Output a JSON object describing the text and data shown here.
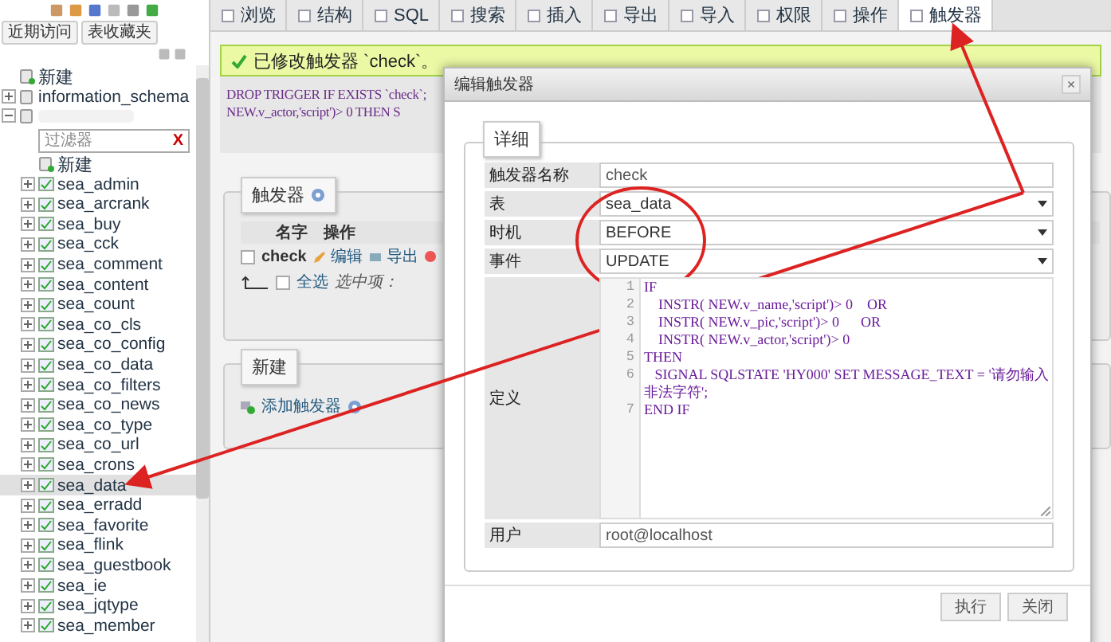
{
  "sidebar": {
    "tabs": [
      {
        "label": "近期访问"
      },
      {
        "label": "表收藏夹"
      }
    ],
    "tree": [
      {
        "kind": "new",
        "label": "新建"
      },
      {
        "kind": "db",
        "label": "information_schema",
        "expanded": false
      },
      {
        "kind": "hidden-db",
        "expanded": true,
        "filter": {
          "placeholder": "过滤器",
          "clear": "X"
        },
        "children": [
          {
            "kind": "new",
            "label": "新建"
          },
          {
            "kind": "table",
            "label": "sea_admin",
            "selected": false
          },
          {
            "kind": "table",
            "label": "sea_arcrank",
            "selected": false
          },
          {
            "kind": "table",
            "label": "sea_buy",
            "selected": false
          },
          {
            "kind": "table",
            "label": "sea_cck",
            "selected": false
          },
          {
            "kind": "table",
            "label": "sea_comment",
            "selected": false
          },
          {
            "kind": "table",
            "label": "sea_content",
            "selected": false
          },
          {
            "kind": "table",
            "label": "sea_count",
            "selected": false
          },
          {
            "kind": "table",
            "label": "sea_co_cls",
            "selected": false
          },
          {
            "kind": "table",
            "label": "sea_co_config",
            "selected": false
          },
          {
            "kind": "table",
            "label": "sea_co_data",
            "selected": false
          },
          {
            "kind": "table",
            "label": "sea_co_filters",
            "selected": false
          },
          {
            "kind": "table",
            "label": "sea_co_news",
            "selected": false
          },
          {
            "kind": "table",
            "label": "sea_co_type",
            "selected": false
          },
          {
            "kind": "table",
            "label": "sea_co_url",
            "selected": false
          },
          {
            "kind": "table",
            "label": "sea_crons",
            "selected": false
          },
          {
            "kind": "table",
            "label": "sea_data",
            "selected": true
          },
          {
            "kind": "table",
            "label": "sea_erradd",
            "selected": false
          },
          {
            "kind": "table",
            "label": "sea_favorite",
            "selected": false
          },
          {
            "kind": "table",
            "label": "sea_flink",
            "selected": false
          },
          {
            "kind": "table",
            "label": "sea_guestbook",
            "selected": false
          },
          {
            "kind": "table",
            "label": "sea_ie",
            "selected": false
          },
          {
            "kind": "table",
            "label": "sea_jqtype",
            "selected": false
          },
          {
            "kind": "table",
            "label": "sea_member",
            "selected": false
          }
        ]
      }
    ]
  },
  "tabs": [
    {
      "label": "浏览",
      "selected": false
    },
    {
      "label": "结构",
      "selected": false
    },
    {
      "label": "SQL",
      "selected": false
    },
    {
      "label": "搜索",
      "selected": false
    },
    {
      "label": "插入",
      "selected": false
    },
    {
      "label": "导出",
      "selected": false
    },
    {
      "label": "导入",
      "selected": false
    },
    {
      "label": "权限",
      "selected": false
    },
    {
      "label": "操作",
      "selected": false
    },
    {
      "label": "触发器",
      "selected": true
    }
  ],
  "message": {
    "text": "已修改触发器 `check`。"
  },
  "sql_preview": {
    "lines": [
      "DROP TRIGGER IF EXISTS `check`;",
      "NEW.v_actor,'script')> 0 THEN S"
    ]
  },
  "triggers_panel": {
    "legend": "触发器",
    "columns": [
      "名字",
      "操作"
    ],
    "rows": [
      {
        "name": "check",
        "checked": false,
        "actions": [
          {
            "kind": "edit",
            "label": "编辑"
          },
          {
            "kind": "export",
            "label": "导出"
          }
        ]
      }
    ],
    "footer": {
      "checked": false,
      "select_all": "全选",
      "with_selected": "选中项："
    }
  },
  "new_panel": {
    "legend": "新建",
    "link": "添加触发器"
  },
  "dialog": {
    "title": "编辑触发器",
    "close": "×",
    "legend": "详细",
    "fields": [
      {
        "kind": "text",
        "label": "触发器名称",
        "value": "check"
      },
      {
        "kind": "select",
        "label": "表",
        "value": "sea_data"
      },
      {
        "kind": "select",
        "label": "时机",
        "value": "BEFORE"
      },
      {
        "kind": "select",
        "label": "事件",
        "value": "UPDATE"
      },
      {
        "kind": "code",
        "label": "定义",
        "lines": [
          {
            "number": "1",
            "text": "IF"
          },
          {
            "number": "2",
            "text": "    INSTR( NEW.v_name,'script')> 0    OR"
          },
          {
            "number": "3",
            "text": "    INSTR( NEW.v_pic,'script')> 0      OR"
          },
          {
            "number": "4",
            "text": "    INSTR( NEW.v_actor,'script')> 0"
          },
          {
            "number": "5",
            "text": "THEN"
          },
          {
            "number": "6",
            "text": "   SIGNAL SQLSTATE 'HY000' SET MESSAGE_TEXT = '请勿输入非法字符';"
          },
          {
            "number": "7",
            "text": "END IF"
          }
        ]
      },
      {
        "kind": "text",
        "label": "用户",
        "value": "root@localhost"
      }
    ],
    "buttons": [
      "执行",
      "关闭"
    ]
  }
}
